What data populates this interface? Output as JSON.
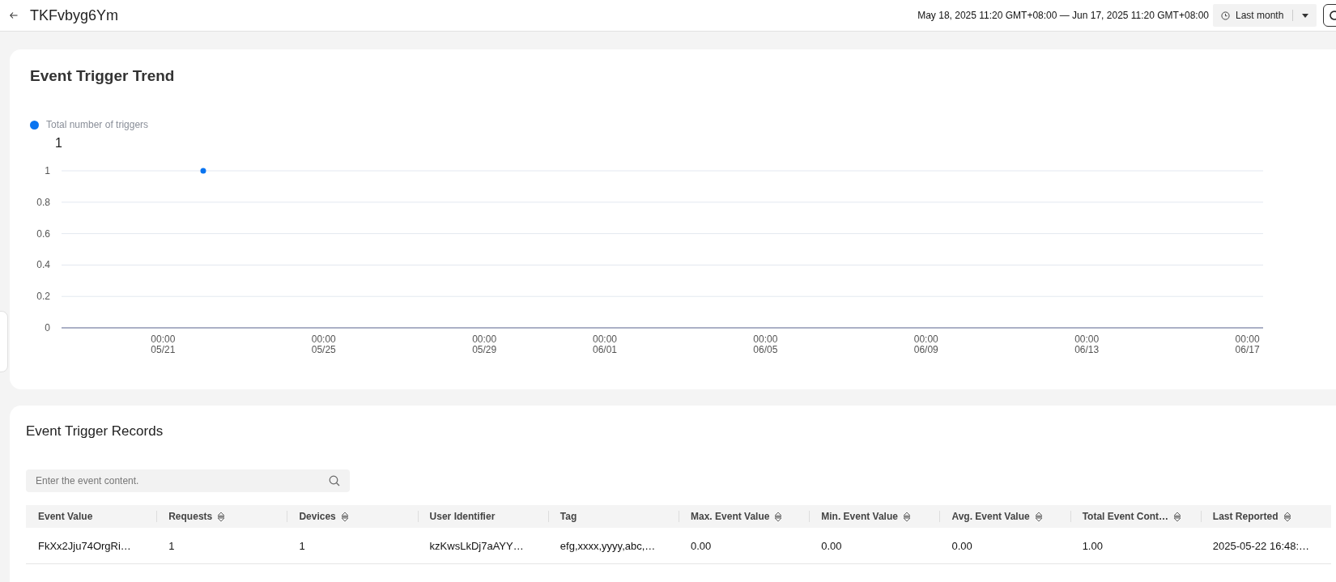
{
  "header": {
    "title": "TKFvbyg6Ym",
    "date_range": "May 18, 2025 11:20 GMT+08:00 — Jun 17, 2025 11:20 GMT+08:00",
    "period": "Last month"
  },
  "trend": {
    "title": "Event Trigger Trend",
    "chart_data": {
      "type": "scatter",
      "grid": true,
      "ylabel": "1",
      "ylim": [
        0,
        1
      ],
      "yticks": [
        0,
        0.2,
        0.4,
        0.6,
        0.8,
        1
      ],
      "categories": [
        null,
        null,
        "00:00\n05/21",
        null,
        null,
        null,
        "00:00\n05/25",
        null,
        null,
        null,
        "00:00\n05/29",
        null,
        null,
        "00:00\n06/01",
        null,
        null,
        null,
        "00:00\n06/05",
        null,
        null,
        null,
        "00:00\n06/09",
        null,
        null,
        null,
        "00:00\n06/13",
        null,
        null,
        null,
        "00:00\n06/17"
      ],
      "series": [
        {
          "name": "Total number of triggers",
          "color": "#0a74f0",
          "values": [
            null,
            null,
            null,
            1,
            null,
            null,
            null,
            null,
            null,
            null,
            null,
            null,
            null,
            null,
            null,
            null,
            null,
            null,
            null,
            null,
            null,
            null,
            null,
            null,
            null,
            null,
            null,
            null,
            null,
            null
          ]
        }
      ]
    }
  },
  "records": {
    "title": "Event Trigger Records",
    "search": {
      "placeholder": "Enter the event content."
    },
    "columns": [
      {
        "label": "Event Value",
        "sortable": false
      },
      {
        "label": "Requests",
        "sortable": true
      },
      {
        "label": "Devices",
        "sortable": true
      },
      {
        "label": "User Identifier",
        "sortable": false
      },
      {
        "label": "Tag",
        "sortable": false
      },
      {
        "label": "Max. Event Value",
        "sortable": true
      },
      {
        "label": "Min. Event Value",
        "sortable": true
      },
      {
        "label": "Avg. Event Value",
        "sortable": true
      },
      {
        "label": "Total Event Cont…",
        "sortable": true
      },
      {
        "label": "Last Reported",
        "sortable": true
      }
    ],
    "rows": [
      [
        "FkXx2Jju74OrgRi…",
        "1",
        "1",
        "kzKwsLkDj7aAYY…",
        "efg,xxxx,yyyy,abc,…",
        "0.00",
        "0.00",
        "0.00",
        "1.00",
        "2025-05-22 16:48:…"
      ]
    ]
  }
}
